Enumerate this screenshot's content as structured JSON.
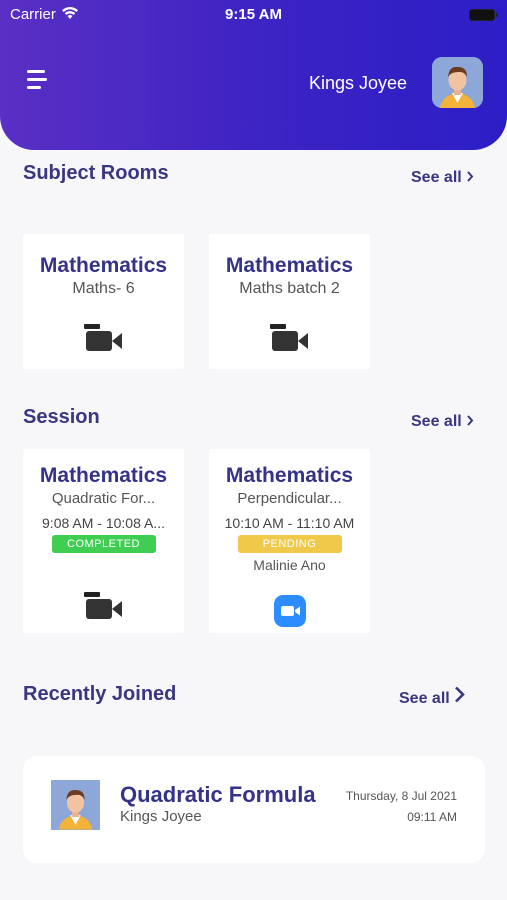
{
  "status_bar": {
    "carrier": "Carrier",
    "time": "9:15 AM"
  },
  "header": {
    "user_name": "Kings Joyee"
  },
  "subject_rooms": {
    "title": "Subject Rooms",
    "see_all": "See all",
    "cards": [
      {
        "title": "Mathematics",
        "subtitle": "Maths- 6"
      },
      {
        "title": "Mathematics",
        "subtitle": "Maths batch 2"
      }
    ]
  },
  "session": {
    "title": "Session",
    "see_all": "See all",
    "cards": [
      {
        "title": "Mathematics",
        "subtitle": "Quadratic For...",
        "time": "9:08 AM - 10:08 A...",
        "status": "COMPLETED",
        "icon": "video-camera-icon"
      },
      {
        "title": "Mathematics",
        "subtitle": "Perpendicular...",
        "time": "10:10 AM - 11:10 AM",
        "status": "PENDING",
        "host": "Malinie Ano",
        "icon": "zoom-icon"
      }
    ]
  },
  "recently_joined": {
    "title": "Recently Joined",
    "see_all": "See all",
    "item": {
      "title": "Quadratic Formula",
      "name": "Kings Joyee",
      "date": "Thursday, 8 Jul 2021",
      "time": "09:11 AM"
    }
  },
  "colors": {
    "header_start": "#5a2fc4",
    "header_end": "#2c1ec6",
    "accent": "#3a3782",
    "completed": "#3fce52",
    "pending": "#f1c94a",
    "zoom": "#2d8cff"
  }
}
